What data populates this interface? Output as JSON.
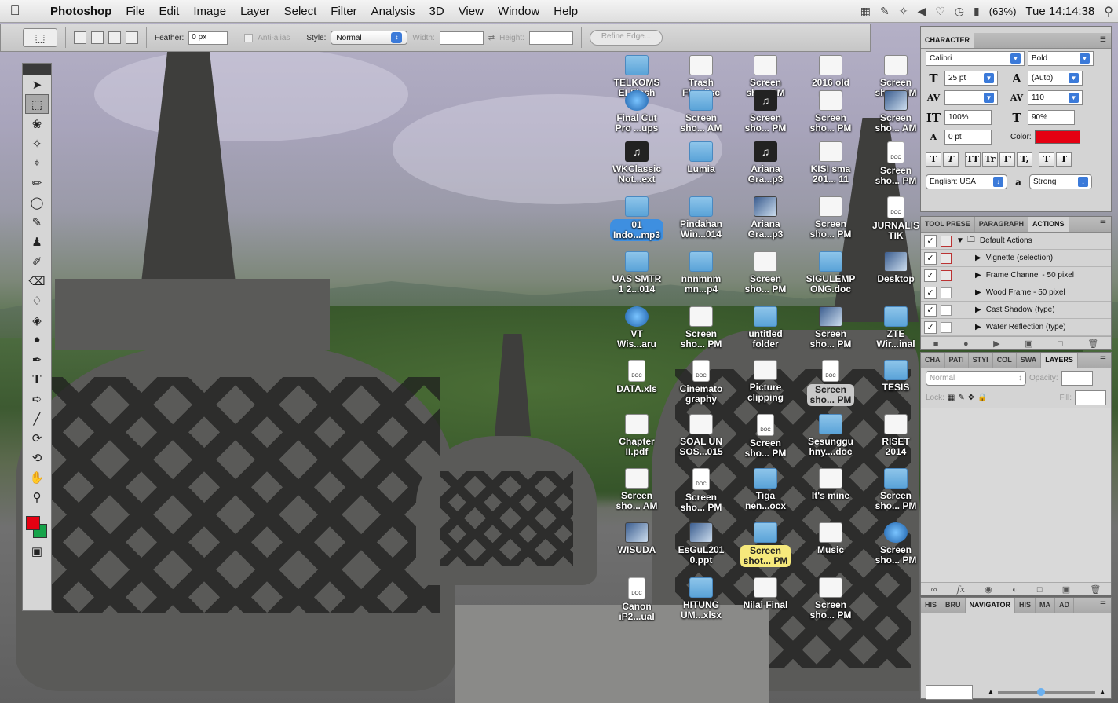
{
  "menubar": {
    "app_name": "Photoshop",
    "items": [
      "File",
      "Edit",
      "Image",
      "Layer",
      "Select",
      "Filter",
      "Analysis",
      "3D",
      "View",
      "Window",
      "Help"
    ],
    "battery": "(63%)",
    "clock": "Tue 14:14:38"
  },
  "options": {
    "feather_label": "Feather:",
    "feather_value": "0 px",
    "antialias_label": "Anti-alias",
    "style_label": "Style:",
    "style_value": "Normal",
    "width_label": "Width:",
    "height_label": "Height:",
    "refine_label": "Refine Edge..."
  },
  "desktop_icons": [
    {
      "label": "TELKOMS\nELFlash",
      "type": "folder"
    },
    {
      "label": "Trash\nFlasdisc",
      "type": "shot"
    },
    {
      "label": "Screen\nsho...PM",
      "type": "shot"
    },
    {
      "label": "2016 old\nsong",
      "type": "shot"
    },
    {
      "label": "Screen\nsho... AM",
      "type": "shot"
    },
    {
      "label": "Final Cut\nPro ...ups",
      "type": "app"
    },
    {
      "label": "Screen\nsho... AM",
      "type": "folder"
    },
    {
      "label": "Screen\nsho... PM",
      "type": "music"
    },
    {
      "label": "Screen\nsho... PM",
      "type": "shot"
    },
    {
      "label": "Screen\nsho... AM",
      "type": "photo"
    },
    {
      "label": "WKClassic\nNot...ext",
      "type": "music"
    },
    {
      "label": "Lumia",
      "type": "folder"
    },
    {
      "label": "Ariana\nGra...p3",
      "type": "music"
    },
    {
      "label": "KISI sma\n201... 11",
      "type": "shot"
    },
    {
      "label": "Screen\nsho... PM",
      "type": "doc"
    },
    {
      "label": "01\nIndo...mp3",
      "type": "folder",
      "style": "sel"
    },
    {
      "label": "Pindahan\nWin...014",
      "type": "folder"
    },
    {
      "label": "Ariana\nGra...p3",
      "type": "photo"
    },
    {
      "label": "Screen\nsho... PM",
      "type": "shot"
    },
    {
      "label": "JURNALIS\nTIK",
      "type": "doc"
    },
    {
      "label": "UAS SMTR\n1 2...014",
      "type": "folder"
    },
    {
      "label": "nnnmnm\nmn...p4",
      "type": "folder"
    },
    {
      "label": "Screen\nsho... PM",
      "type": "shot"
    },
    {
      "label": "SIGULEMP\nONG.doc",
      "type": "folder"
    },
    {
      "label": "Desktop",
      "type": "photo"
    },
    {
      "label": "VT\nWis...aru",
      "type": "app"
    },
    {
      "label": "Screen\nsho... PM",
      "type": "shot"
    },
    {
      "label": "untitled\nfolder",
      "type": "folder"
    },
    {
      "label": "Screen\nsho... PM",
      "type": "photo"
    },
    {
      "label": "ZTE\nWir...inal",
      "type": "folder"
    },
    {
      "label": "DATA.xls",
      "type": "doc"
    },
    {
      "label": "Cinemato\ngraphy",
      "type": "doc"
    },
    {
      "label": "Picture\nclipping",
      "type": "shot"
    },
    {
      "label": "Screen\nsho... PM",
      "type": "doc",
      "style": "grey"
    },
    {
      "label": "TESIS",
      "type": "folder"
    },
    {
      "label": "Chapter\nII.pdf",
      "type": "shot"
    },
    {
      "label": "SOAL UN\nSOS...015",
      "type": "shot"
    },
    {
      "label": "Screen\nsho... PM",
      "type": "doc"
    },
    {
      "label": "Sesunggu\nhny....doc",
      "type": "folder"
    },
    {
      "label": "RISET\n2014",
      "type": "shot"
    },
    {
      "label": "Screen\nsho... AM",
      "type": "shot"
    },
    {
      "label": "Screen\nsho... PM",
      "type": "doc"
    },
    {
      "label": "Tiga\nnen...ocx",
      "type": "folder"
    },
    {
      "label": "It's mine",
      "type": "shot"
    },
    {
      "label": "Screen\nsho... PM",
      "type": "folder"
    },
    {
      "label": "WISUDA",
      "type": "photo"
    },
    {
      "label": "EsGuL201\n0.ppt",
      "type": "photo"
    },
    {
      "label": "Screen\nshot... PM",
      "type": "folder",
      "style": "hl"
    },
    {
      "label": "Music",
      "type": "shot"
    },
    {
      "label": "Screen\nsho... PM",
      "type": "app"
    },
    {
      "label": "Canon\niP2...ual",
      "type": "doc"
    },
    {
      "label": "HITUNG\nUM...xlsx",
      "type": "folder"
    },
    {
      "label": "Nilai Final",
      "type": "shot"
    },
    {
      "label": "Screen\nsho... PM",
      "type": "shot"
    }
  ],
  "character": {
    "tab": "CHARACTER",
    "font": "Calibri",
    "weight": "Bold",
    "size": "25 pt",
    "leading": "(Auto)",
    "tracking": "110",
    "vscale": "100%",
    "hscale": "90%",
    "baseline": "0 pt",
    "color_label": "Color:",
    "color_hex": "#e50012",
    "language": "English: USA",
    "antialias": "Strong",
    "aa_glyph": "a"
  },
  "actions_panel": {
    "tabs": [
      "TOOL PRESE",
      "PARAGRAPH",
      "ACTIONS"
    ],
    "items": [
      "Default Actions",
      "Vignette (selection)",
      "Frame Channel - 50 pixel",
      "Wood Frame - 50 pixel",
      "Cast Shadow (type)",
      "Water Reflection (type)"
    ]
  },
  "layers_panel": {
    "tabs": [
      "CHA",
      "PATI",
      "STYI",
      "COL",
      "SWA",
      "LAYERS"
    ],
    "blend": "Normal",
    "opacity_label": "Opacity:",
    "lock_label": "Lock:",
    "fill_label": "Fill:"
  },
  "navigator_panel": {
    "tabs": [
      "HIS",
      "BRU",
      "NAVIGATOR",
      "HIS",
      "MA",
      "AD"
    ]
  }
}
